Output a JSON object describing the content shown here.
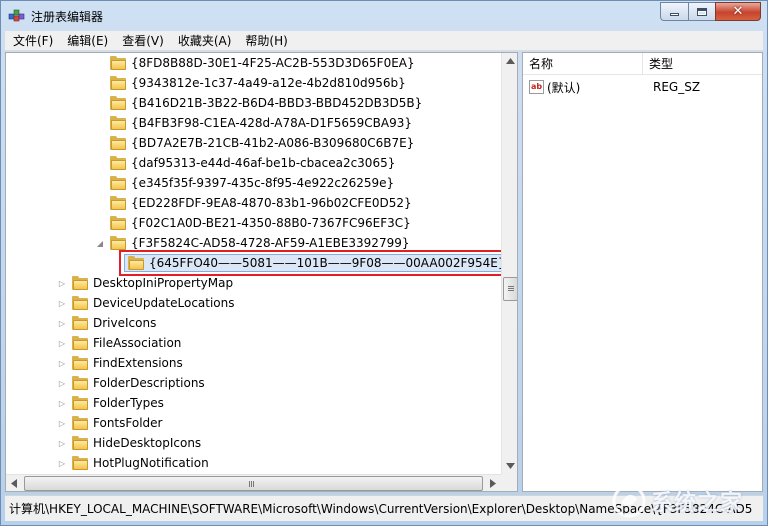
{
  "window": {
    "title": "注册表编辑器",
    "close_glyph": "✕"
  },
  "menu": [
    {
      "label": "文件(F)"
    },
    {
      "label": "编辑(E)"
    },
    {
      "label": "查看(V)"
    },
    {
      "label": "收藏夹(A)"
    },
    {
      "label": "帮助(H)"
    }
  ],
  "tree": {
    "child_items": [
      "{8FD8B88D-30E1-4F25-AC2B-553D3D65F0EA}",
      "{9343812e-1c37-4a49-a12e-4b2d810d956b}",
      "{B416D21B-3B22-B6D4-BBD3-BBD452DB3D5B}",
      "{B4FB3F98-C1EA-428d-A78A-D1F5659CBA93}",
      "{BD7A2E7B-21CB-41b2-A086-B309680C6B7E}",
      "{daf95313-e44d-46af-be1b-cbacea2c3065}",
      "{e345f35f-9397-435c-8f95-4e922c26259e}",
      "{ED228FDF-9EA8-4870-83b1-96b02CFE0D52}",
      "{F02C1A0D-BE21-4350-88B0-7367FC96EF3C}"
    ],
    "expanded_item": "{F3F5824C-AD58-4728-AF59-A1EBE3392799}",
    "selected_item": "{645FFO40——5081——101B——9F08——00AA002F954E}",
    "sibling_items": [
      "DesktopIniPropertyMap",
      "DeviceUpdateLocations",
      "DriveIcons",
      "FileAssociation",
      "FindExtensions",
      "FolderDescriptions",
      "FolderTypes",
      "FontsFolder",
      "HideDesktopIcons",
      "HotPlugNotification"
    ],
    "expand_glyph": "▷",
    "collapse_glyph": "◢"
  },
  "list": {
    "columns": {
      "name": "名称",
      "type": "类型"
    },
    "rows": [
      {
        "name": "(默认)",
        "type": "REG_SZ",
        "icon_text": "ab"
      }
    ]
  },
  "status": {
    "path": "计算机\\HKEY_LOCAL_MACHINE\\SOFTWARE\\Microsoft\\Windows\\CurrentVersion\\Explorer\\Desktop\\NameSpace\\{F3F5824C-AD5"
  },
  "watermark": {
    "text": "系统之家"
  },
  "colors": {
    "highlight_box": "#e21f26",
    "selection_bg": "#dbe7f6",
    "folder": "#f3c44a"
  }
}
